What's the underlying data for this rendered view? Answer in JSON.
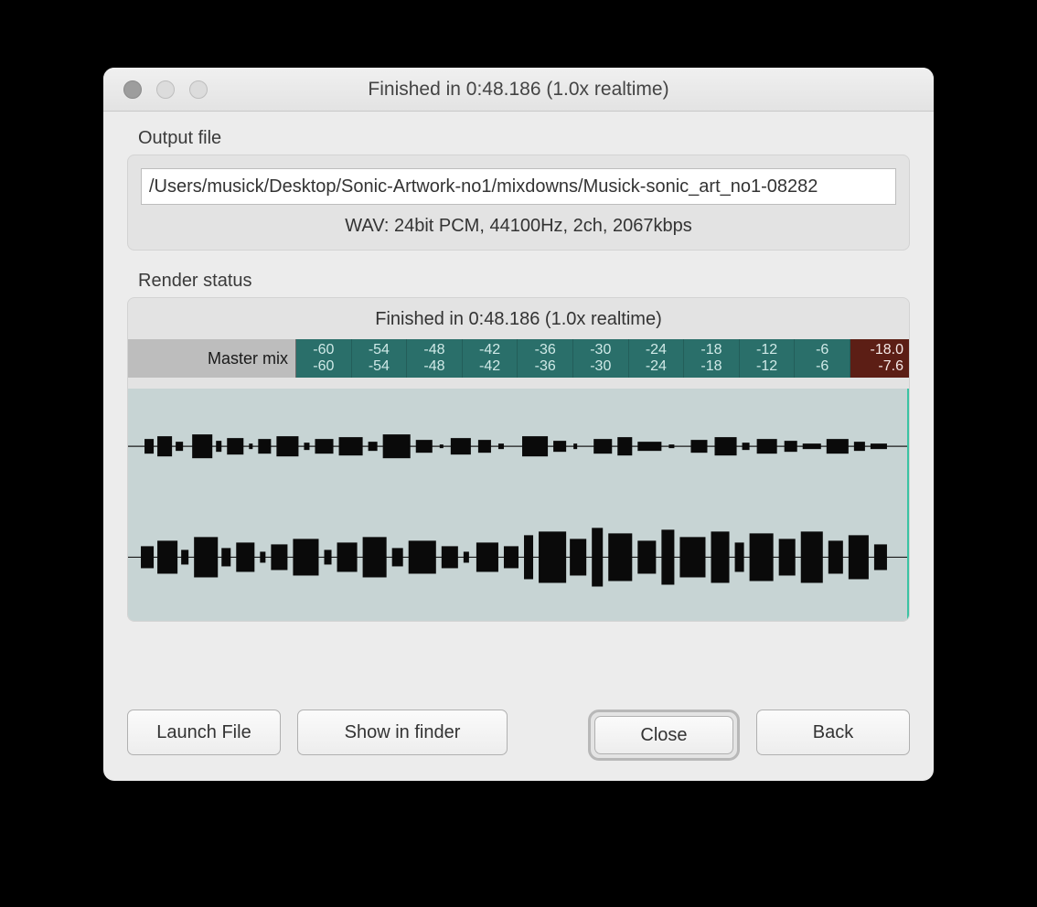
{
  "window": {
    "title": "Finished in 0:48.186 (1.0x realtime)"
  },
  "output": {
    "section_label": "Output file",
    "path": "/Users/musick/Desktop/Sonic-Artwork-no1/mixdowns/Musick-sonic_art_no1-08282",
    "format": "WAV: 24bit PCM, 44100Hz, 2ch, 2067kbps"
  },
  "render": {
    "section_label": "Render status",
    "status_text": "Finished in 0:48.186 (1.0x realtime)",
    "mix_label": "Master mix",
    "db_ticks": [
      "-60",
      "-54",
      "-48",
      "-42",
      "-36",
      "-30",
      "-24",
      "-18",
      "-12",
      "-6"
    ],
    "peak_top": "-18.0",
    "peak_bottom": "-7.6"
  },
  "buttons": {
    "launch": "Launch File",
    "finder": "Show in finder",
    "close": "Close",
    "back": "Back"
  }
}
